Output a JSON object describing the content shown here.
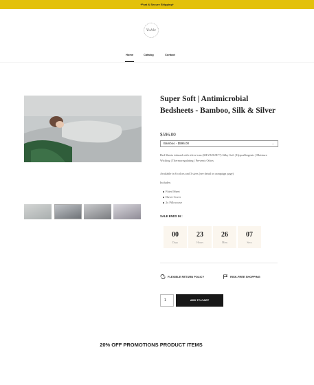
{
  "announcement": "*Fast & Secure Shipping*",
  "brand": {
    "logo_text": "Vuhle"
  },
  "nav": {
    "items": [
      {
        "label": "Home"
      },
      {
        "label": "Catalog"
      },
      {
        "label": "Contact"
      }
    ],
    "active": "Home"
  },
  "product": {
    "title": "Super Soft | Antimicrobial Bedsheets - Bamboo, Silk & Silver",
    "price": "$596.00",
    "variant_selected": "Bamboo - $596.00",
    "description": "Bed Sheets infused with silver ions (SILVADUR™) Silky Soft | Hypoallergenic | Moisture Wicking | Thermoregulating | Prevents Odors",
    "availability": "Available in 6 colors and 3 sizes (see detail in campaign page)",
    "includes_label": "Includes:",
    "includes": [
      "Fitted Sheet",
      "Duvet Cover",
      "2x Pillowcase"
    ]
  },
  "sale": {
    "label": "SALE ENDS IN :",
    "countdown": [
      {
        "value": "00",
        "unit": "Days"
      },
      {
        "value": "23",
        "unit": "Hours"
      },
      {
        "value": "26",
        "unit": "Mins"
      },
      {
        "value": "07",
        "unit": "Secs"
      }
    ]
  },
  "policies": [
    {
      "label": "FLEXIBLE RETURN POLICY",
      "icon": "return-icon"
    },
    {
      "label": "RISK-FREE SHOPPING",
      "icon": "flag-icon"
    }
  ],
  "cart": {
    "quantity": "1",
    "button_label": "ADD TO CART"
  },
  "promo_heading": "20% OFF PROMOTIONS PRODUCT ITEMS",
  "colors": {
    "announcement_bar": "#e3c10b",
    "button": "#181818",
    "countdown_bg": "#fbf6ee"
  }
}
